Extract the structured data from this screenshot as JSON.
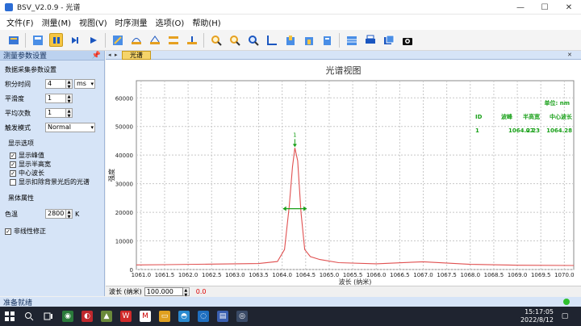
{
  "window": {
    "title": "BSV_V2.0.9 - 光谱"
  },
  "menu": [
    "文件(F)",
    "测量(M)",
    "视图(V)",
    "时序测量",
    "选项(O)",
    "帮助(H)"
  ],
  "left_panel": {
    "title": "测量参数设置",
    "acq_group": "数据采集参数设置",
    "integration_label": "积分时间",
    "integration_value": "4",
    "integration_unit": "ms",
    "smoothing_label": "平滑度",
    "smoothing_value": "1",
    "average_label": "平均次数",
    "average_value": "1",
    "trigger_label": "触发模式",
    "trigger_value": "Normal",
    "display_group": "显示选项",
    "show_peak": "显示峰值",
    "show_fwhm": "显示半高宽",
    "center_wl": "中心波长",
    "show_bg_removed": "显示扣除背景光后的光谱",
    "blackbody_group": "黑体属性",
    "color_temp_label": "色温",
    "color_temp_value": "2800",
    "color_temp_unit": "K",
    "nonlinear": "非线性修正"
  },
  "doc_tab": "光谱",
  "chart_data": {
    "type": "line",
    "title": "光谱视图",
    "xlabel": "波长 (纳米)",
    "ylabel": "强度",
    "xlim": [
      1060.9,
      1070.2
    ],
    "ylim": [
      0,
      66000
    ],
    "x_ticks": [
      "1061.0",
      "1061.5",
      "1062.0",
      "1062.5",
      "1063.0",
      "1063.5",
      "1064.0",
      "1064.5",
      "1065.0",
      "1065.5",
      "1066.0",
      "1066.5",
      "1067.0",
      "1067.5",
      "1068.0",
      "1068.5",
      "1069.0",
      "1069.5",
      "1070.0"
    ],
    "y_ticks": [
      "0",
      "10000",
      "20000",
      "30000",
      "40000",
      "50000",
      "60000"
    ],
    "grid": true,
    "line_color": "#e05050",
    "peak_marker": "1",
    "x": [
      1060.9,
      1061.5,
      1062.5,
      1063.5,
      1063.9,
      1064.05,
      1064.15,
      1064.22,
      1064.27,
      1064.33,
      1064.4,
      1064.48,
      1064.6,
      1064.8,
      1065.2,
      1066.0,
      1067.0,
      1068.0,
      1069.0,
      1070.2
    ],
    "y": [
      1600,
      1700,
      1900,
      2100,
      2800,
      7000,
      22000,
      36000,
      42500,
      38000,
      20000,
      7000,
      4500,
      3500,
      2400,
      2000,
      2700,
      1800,
      1500,
      1400
    ],
    "annotation": {
      "unit": "单位: nm",
      "headers": [
        "ID",
        "波峰",
        "半高宽",
        "中心波长"
      ],
      "row": [
        "1",
        "1064.27",
        "0.23",
        "1064.28"
      ]
    }
  },
  "wave_bar": {
    "label": "波长 (纳米)",
    "input": "100.000",
    "readout": "0.0"
  },
  "status": {
    "text": "准备就绪"
  },
  "taskbar": {
    "time": "15:17:05",
    "date": "2022/8/12"
  }
}
